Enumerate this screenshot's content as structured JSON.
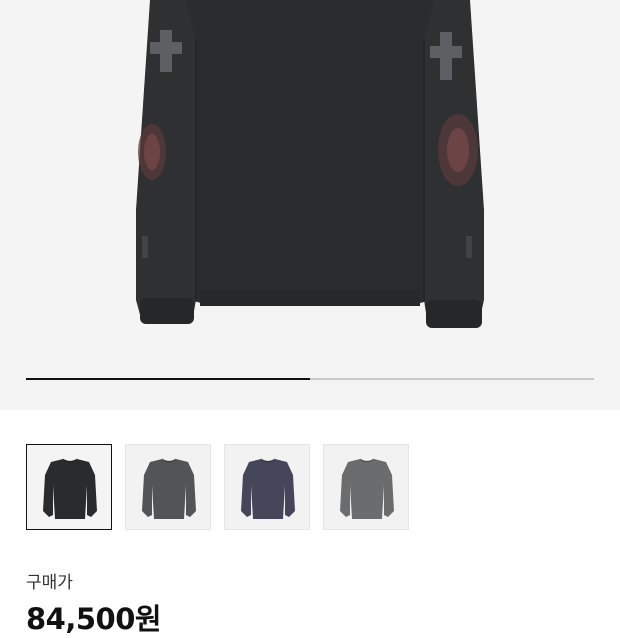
{
  "gallery": {
    "progress_fraction": 0.5,
    "thumbnails": [
      {
        "name": "black",
        "color": "#2a2b2d",
        "selected": true
      },
      {
        "name": "charcoal",
        "color": "#535455",
        "selected": false
      },
      {
        "name": "navy-gray",
        "color": "#45465a",
        "selected": false
      },
      {
        "name": "gray",
        "color": "#6a6c6d",
        "selected": false
      }
    ]
  },
  "product": {
    "price_label": "구매가",
    "price_value": "84,500원"
  }
}
